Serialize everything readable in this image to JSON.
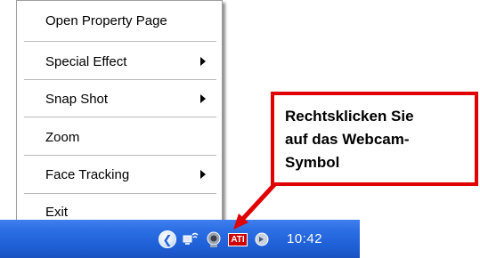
{
  "context_menu": {
    "items": [
      {
        "label": "Open Property Page",
        "has_submenu": false
      },
      {
        "label": "Special Effect",
        "has_submenu": true
      },
      {
        "label": "Snap Shot",
        "has_submenu": true
      },
      {
        "label": "Zoom",
        "has_submenu": false
      },
      {
        "label": "Face Tracking",
        "has_submenu": true
      },
      {
        "label": "Exit",
        "has_submenu": false
      }
    ]
  },
  "callout": {
    "lines": [
      "Rechtsklicken Sie",
      "auf das Webcam-",
      "Symbol"
    ],
    "border_color": "#e00000"
  },
  "taskbar": {
    "clock": "10:42",
    "ati_label": "ATI",
    "tray_icons": [
      "show-hidden-icons-chevron",
      "network-icon",
      "webcam-icon",
      "ati-icon",
      "volume-icon"
    ]
  },
  "colors": {
    "taskbar": "#1f5fd6",
    "accent_red": "#e00000"
  }
}
